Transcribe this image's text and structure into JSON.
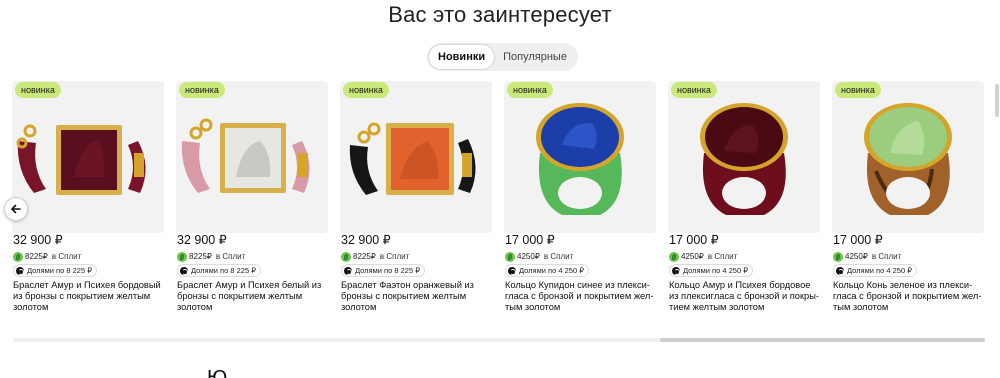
{
  "section_title": "Вас это заинтересует",
  "tabs": [
    {
      "label": "Новинки",
      "active": true
    },
    {
      "label": "Популярные",
      "active": false
    }
  ],
  "badge_label": "новинка",
  "split_label": "в Сплит",
  "products": [
    {
      "price": "32 900 ₽",
      "cashback": "8225₽",
      "installment": "Долями по 8 225 ₽",
      "title": "Браслет Амур и Психея бордовый из бронзы с покрытием желтым золотом",
      "image": "bracelet-burgundy"
    },
    {
      "price": "32 900 ₽",
      "cashback": "8225₽",
      "installment": "Долями по 8 225 ₽",
      "title": "Браслет Амур и Психея белый из бронзы с покрытием желтым золотом",
      "image": "bracelet-white"
    },
    {
      "price": "32 900 ₽",
      "cashback": "8225₽",
      "installment": "Долями по 8 225 ₽",
      "title": "Браслет Фаэтон оранжевый из бронзы с покрытием желтым золотом",
      "image": "bracelet-orange"
    },
    {
      "price": "17 000 ₽",
      "cashback": "4250₽",
      "installment": "Долями по 4 250 ₽",
      "title": "Кольцо Купидон синее из плекси-гласа с бронзой и покрытием жел-тым золотом",
      "image": "ring-blue-green"
    },
    {
      "price": "17 000 ₽",
      "cashback": "4250₽",
      "installment": "Долями по 4 250 ₽",
      "title": "Кольцо Амур и Психея бордовое из плексигласа с бронзой и покры-тием желтым золотом",
      "image": "ring-burgundy"
    },
    {
      "price": "17 000 ₽",
      "cashback": "4250₽",
      "installment": "Долями по 4 250 ₽",
      "title": "Кольцо Конь зеленое из плекси-гласа с бронзой и покрытием жел-тым золотом",
      "image": "ring-green-tortoise"
    }
  ],
  "next_heading": "Ю",
  "colors": {
    "badge": "#cbe87a",
    "card_bg": "#f2f2f2",
    "cashback_green": "#6cc24a"
  }
}
